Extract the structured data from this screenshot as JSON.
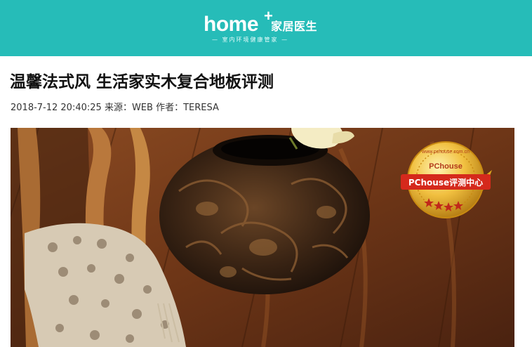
{
  "header": {
    "logo_word": "home",
    "logo_plus": "+",
    "logo_cn": "家居医生",
    "logo_slogan": "— 室内环境健康管家 —",
    "background_color": "#26bcb8"
  },
  "article": {
    "title": "温馨法式风 生活家实木复合地板评测",
    "date": "2018-7-12 20:40:25",
    "source": "来源：WEB",
    "author": "作者：TERESA"
  },
  "photo": {
    "badge": {
      "brand": "PChouse",
      "url": "www.pchouse.com.cn",
      "label": "PChouse评测中心"
    }
  }
}
